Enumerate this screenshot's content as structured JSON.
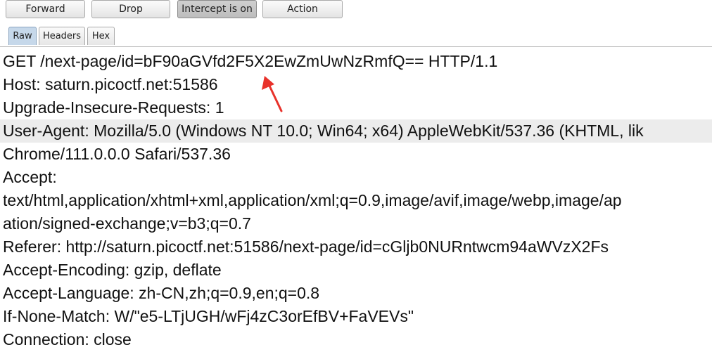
{
  "toolbar": {
    "forward": "Forward",
    "drop": "Drop",
    "intercept": "Intercept is on",
    "action": "Action"
  },
  "tabs": {
    "raw": "Raw",
    "headers": "Headers",
    "hex": "Hex"
  },
  "request": {
    "lines": [
      "GET /next-page/id=bF90aGVfd2F5X2EwZmUwNzRmfQ== HTTP/1.1",
      "Host: saturn.picoctf.net:51586",
      "Upgrade-Insecure-Requests: 1",
      "User-Agent: Mozilla/5.0 (Windows NT 10.0; Win64; x64) AppleWebKit/537.36 (KHTML, lik",
      "Chrome/111.0.0.0 Safari/537.36",
      "Accept:",
      "text/html,application/xhtml+xml,application/xml;q=0.9,image/avif,image/webp,image/ap",
      "ation/signed-exchange;v=b3;q=0.7",
      "Referer: http://saturn.picoctf.net:51586/next-page/id=cGljb0NURntwcm94aWVzX2Fs",
      "Accept-Encoding: gzip, deflate",
      "Accept-Language: zh-CN,zh;q=0.9,en;q=0.8",
      "If-None-Match: W/\"e5-LTjUGH/wFj4zC3orEfBV+FaVEVs\"",
      "Connection: close"
    ]
  },
  "colors": {
    "annotation_arrow": "#e8322b",
    "selected_tab": "#c6d8ea",
    "highlight_row": "#ececec"
  },
  "icons": {
    "annotation": "red-arrow-icon"
  }
}
